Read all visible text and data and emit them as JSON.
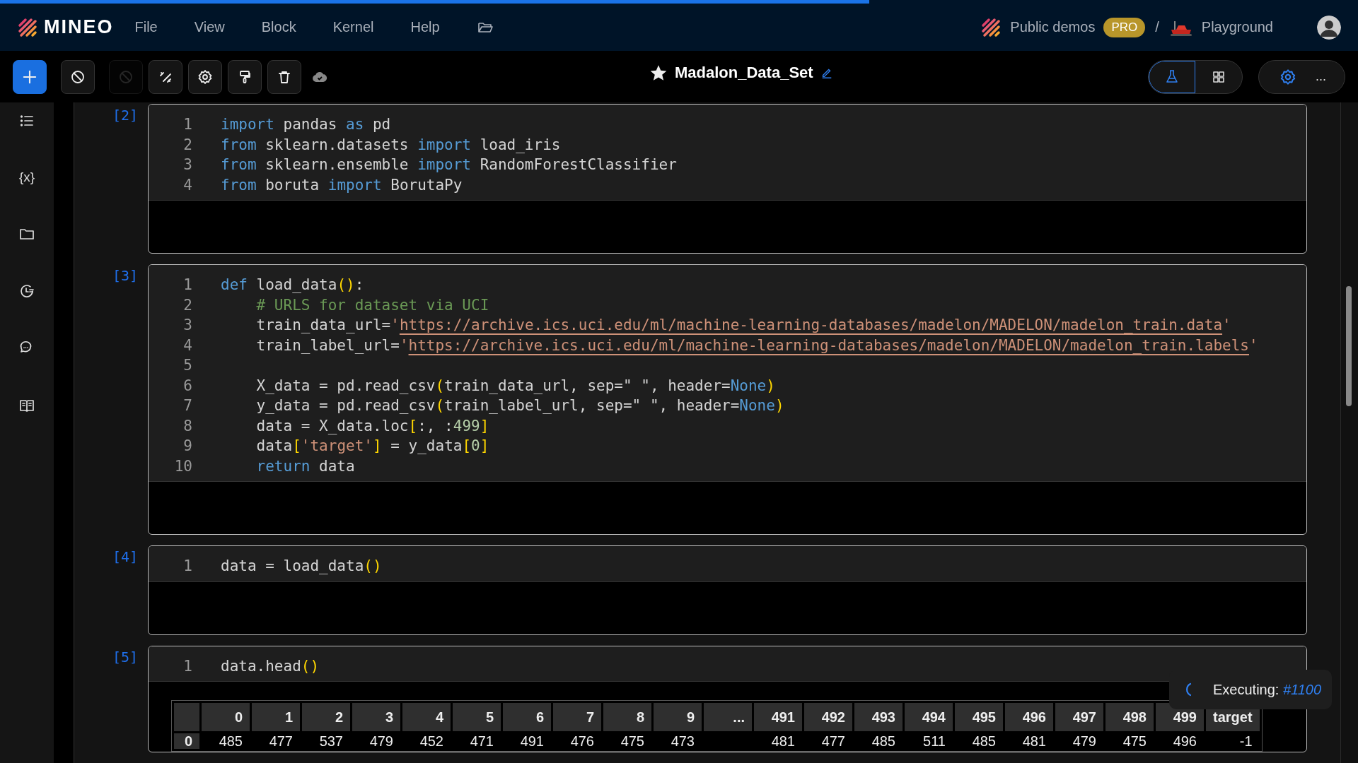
{
  "progress": {
    "level": 0.64
  },
  "app": {
    "brand": "MINEO",
    "menu": [
      "File",
      "View",
      "Block",
      "Kernel",
      "Help"
    ]
  },
  "breadcrumb": {
    "workspace": "Public demos",
    "badge": "PRO",
    "separator": "/",
    "project": "Playground"
  },
  "toolbar": {
    "tools": [
      {
        "kind": "add",
        "disabled": false
      },
      {
        "kind": "stop",
        "disabled": false
      },
      {
        "kind": "stop",
        "disabled": true
      },
      {
        "kind": "unlink",
        "disabled": false
      },
      {
        "kind": "settings",
        "disabled": false
      },
      {
        "kind": "format",
        "disabled": false
      },
      {
        "kind": "delete",
        "disabled": false
      },
      {
        "kind": "cloud",
        "disabled": false
      }
    ],
    "title": "Madalon_Data_Set",
    "views": [
      {
        "kind": "flask",
        "selected": true
      },
      {
        "kind": "grid",
        "selected": false
      }
    ],
    "more": "..."
  },
  "sidebar": [
    {
      "kind": "outline"
    },
    {
      "kind": "variables",
      "glyph": "{x}"
    },
    {
      "kind": "files"
    },
    {
      "kind": "history"
    },
    {
      "kind": "chat"
    },
    {
      "kind": "docs"
    }
  ],
  "cells": [
    {
      "count": "[2]",
      "lines": [
        {
          "n": "1",
          "tokens": [
            {
              "kind": "kw",
              "t": "import"
            },
            {
              "kind": "plain",
              "t": " pandas "
            },
            {
              "kind": "kw",
              "t": "as"
            },
            {
              "kind": "plain",
              "t": " pd"
            }
          ]
        },
        {
          "n": "2",
          "tokens": [
            {
              "kind": "kw",
              "t": "from"
            },
            {
              "kind": "plain",
              "t": " sklearn.datasets "
            },
            {
              "kind": "kw",
              "t": "import"
            },
            {
              "kind": "plain",
              "t": " load_iris"
            }
          ]
        },
        {
          "n": "3",
          "tokens": [
            {
              "kind": "kw",
              "t": "from"
            },
            {
              "kind": "plain",
              "t": " sklearn.ensemble "
            },
            {
              "kind": "kw",
              "t": "import"
            },
            {
              "kind": "plain",
              "t": " RandomForestClassifier"
            }
          ]
        },
        {
          "n": "4",
          "tokens": [
            {
              "kind": "kw",
              "t": "from"
            },
            {
              "kind": "plain",
              "t": " boruta "
            },
            {
              "kind": "kw",
              "t": "import"
            },
            {
              "kind": "plain",
              "t": " BorutaPy"
            }
          ]
        }
      ]
    },
    {
      "count": "[3]",
      "lines": [
        {
          "n": "1",
          "tokens": [
            {
              "kind": "kw",
              "t": "def"
            },
            {
              "kind": "plain",
              "t": " load_data"
            },
            {
              "kind": "paren",
              "t": "()"
            },
            {
              "kind": "plain",
              "t": ":"
            }
          ]
        },
        {
          "n": "2",
          "tokens": [
            {
              "kind": "comment",
              "t": "    # URLS for dataset via UCI"
            }
          ]
        },
        {
          "n": "3",
          "tokens": [
            {
              "kind": "plain",
              "t": "    train_data_url="
            },
            {
              "kind": "str",
              "t": "'"
            },
            {
              "kind": "url",
              "t": "https://archive.ics.uci.edu/ml/machine-learning-databases/madelon/MADELON/madelon_train.data"
            },
            {
              "kind": "str",
              "t": "'"
            }
          ]
        },
        {
          "n": "4",
          "tokens": [
            {
              "kind": "plain",
              "t": "    train_label_url="
            },
            {
              "kind": "str",
              "t": "'"
            },
            {
              "kind": "url",
              "t": "https://archive.ics.uci.edu/ml/machine-learning-databases/madelon/MADELON/madelon_train.labels"
            },
            {
              "kind": "str",
              "t": "'"
            }
          ]
        },
        {
          "n": "5"
        },
        {
          "n": "6",
          "tokens": [
            {
              "kind": "plain",
              "t": "    X_data = pd.read_csv"
            },
            {
              "kind": "paren",
              "t": "("
            },
            {
              "kind": "plain",
              "t": "train_data_url, sep=\" \", header="
            },
            {
              "kind": "kw",
              "t": "None"
            },
            {
              "kind": "paren",
              "t": ")"
            }
          ]
        },
        {
          "n": "7",
          "tokens": [
            {
              "kind": "plain",
              "t": "    y_data = pd.read_csv"
            },
            {
              "kind": "paren",
              "t": "("
            },
            {
              "kind": "plain",
              "t": "train_label_url, sep=\" \", header="
            },
            {
              "kind": "kw",
              "t": "None"
            },
            {
              "kind": "paren",
              "t": ")"
            }
          ]
        },
        {
          "n": "8",
          "tokens": [
            {
              "kind": "plain",
              "t": "    data = X_data.loc"
            },
            {
              "kind": "paren",
              "t": "["
            },
            {
              "kind": "plain",
              "t": ":, :"
            },
            {
              "kind": "num",
              "t": "499"
            },
            {
              "kind": "paren",
              "t": "]"
            }
          ]
        },
        {
          "n": "9",
          "tokens": [
            {
              "kind": "plain",
              "t": "    data"
            },
            {
              "kind": "paren",
              "t": "["
            },
            {
              "kind": "str",
              "t": "'target'"
            },
            {
              "kind": "paren",
              "t": "]"
            },
            {
              "kind": "plain",
              "t": " = y_data"
            },
            {
              "kind": "paren",
              "t": "["
            },
            {
              "kind": "num",
              "t": "0"
            },
            {
              "kind": "paren",
              "t": "]"
            }
          ]
        },
        {
          "n": "10",
          "tokens": [
            {
              "kind": "kw",
              "t": "    return"
            },
            {
              "kind": "plain",
              "t": " data"
            }
          ]
        }
      ]
    },
    {
      "count": "[4]",
      "lines": [
        {
          "n": "1",
          "tokens": [
            {
              "kind": "plain",
              "t": "data = load_data"
            },
            {
              "kind": "paren",
              "t": "()"
            }
          ]
        }
      ]
    },
    {
      "count": "[5]",
      "lines": [
        {
          "n": "1",
          "tokens": [
            {
              "kind": "plain",
              "t": "data.head"
            },
            {
              "kind": "paren",
              "t": "()"
            }
          ]
        }
      ],
      "table": {
        "columns": [
          {
            "kind": "value",
            "label": "0"
          },
          {
            "kind": "value",
            "label": "1"
          },
          {
            "kind": "value",
            "label": "2"
          },
          {
            "kind": "value",
            "label": "3"
          },
          {
            "kind": "value",
            "label": "4"
          },
          {
            "kind": "value",
            "label": "5"
          },
          {
            "kind": "value",
            "label": "6"
          },
          {
            "kind": "value",
            "label": "7"
          },
          {
            "kind": "value",
            "label": "8"
          },
          {
            "kind": "value",
            "label": "9"
          },
          {
            "kind": "ellipsis",
            "label": "..."
          },
          {
            "kind": "value",
            "label": "491"
          },
          {
            "kind": "value",
            "label": "492"
          },
          {
            "kind": "value",
            "label": "493"
          },
          {
            "kind": "value",
            "label": "494"
          },
          {
            "kind": "value",
            "label": "495"
          },
          {
            "kind": "value",
            "label": "496"
          },
          {
            "kind": "value",
            "label": "497"
          },
          {
            "kind": "value",
            "label": "498"
          },
          {
            "kind": "value",
            "label": "499"
          },
          {
            "kind": "value",
            "label": "target"
          }
        ],
        "rows": [
          {
            "index": "0",
            "values": [
              "485",
              "477",
              "537",
              "479",
              "452",
              "471",
              "491",
              "476",
              "475",
              "473",
              "481",
              "477",
              "485",
              "511",
              "485",
              "481",
              "479",
              "475",
              "496",
              "-1"
            ]
          }
        ]
      }
    }
  ],
  "toast": {
    "label": "Executing:",
    "job": "#1100"
  }
}
